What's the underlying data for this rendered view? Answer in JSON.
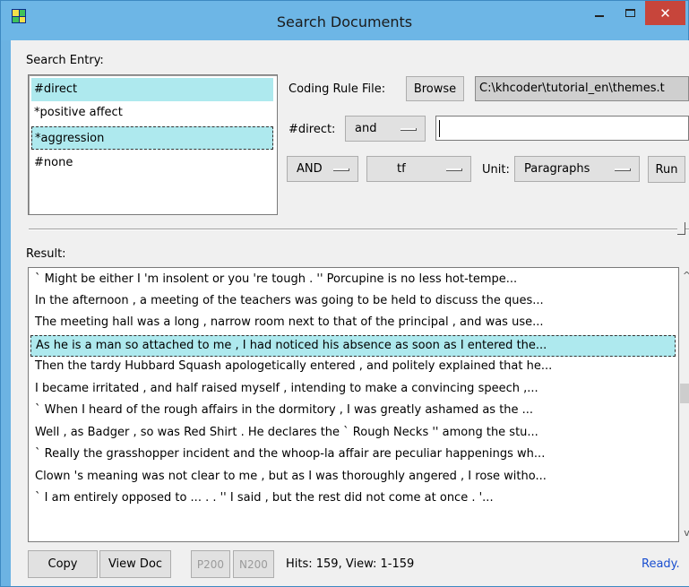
{
  "window": {
    "title": "Search Documents",
    "close_glyph": "✕"
  },
  "search_entry": {
    "label": "Search Entry:",
    "items": [
      "#direct",
      "*positive affect",
      "*aggression",
      "#none"
    ]
  },
  "coding": {
    "label": "Coding Rule File:",
    "browse_label": "Browse",
    "file_path": "C:\\khcoder\\tutorial_en\\themes.t"
  },
  "direct": {
    "label": "#direct:",
    "operator": "and",
    "entry_value": ""
  },
  "options": {
    "logic": "AND",
    "weight": "tf",
    "unit_label": "Unit:",
    "unit": "Paragraphs",
    "run_label": "Run"
  },
  "result": {
    "label": "Result:",
    "rows": [
      "` Might be either I 'm insolent or you 're tough . '' Porcupine is no less hot-tempe...",
      "In the afternoon , a meeting of the teachers was going to be held to discuss the ques...",
      "The meeting hall was a long , narrow room next to that of the principal , and was use...",
      "As he is a man so attached to me , I had noticed his absence as soon as I entered the...",
      "Then the tardy Hubbard Squash apologetically entered , and politely explained that he...",
      "I became irritated , and half raised myself , intending to make a convincing speech ,...",
      "` When I heard of the rough affairs in the dormitory , I was greatly ashamed as the ...",
      "Well , as Badger , so was Red Shirt . He declares the ` Rough Necks '' among the stu...",
      "` Really the grasshopper incident and the whoop-la affair are peculiar happenings wh...",
      "Clown 's meaning was not clear to me , but as I was thoroughly angered , I rose witho...",
      "` I am entirely opposed to ... . . '' I said , but the rest did not come at once . '..."
    ]
  },
  "footer": {
    "copy_label": "Copy",
    "view_doc_label": "View Doc",
    "p200_label": "P200",
    "n200_label": "N200",
    "hits_text": "Hits: 159, View: 1-159",
    "status_text": "Ready."
  },
  "colors": {
    "titlebar": "#6db6e6",
    "selection": "#aee9ee",
    "close_button": "#c7453b",
    "status_ready": "#1a4fd0"
  },
  "icons": {
    "scroll_up": "^",
    "scroll_down": "v"
  }
}
